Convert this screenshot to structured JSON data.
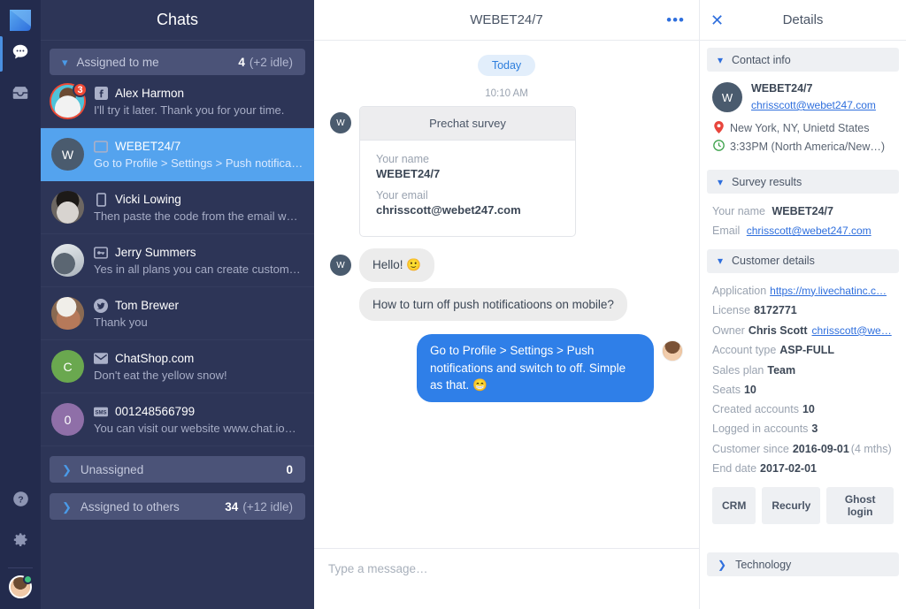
{
  "rail": {
    "logo_icon": "logo-icon",
    "items": [
      {
        "icon": "chat-bubble-icon",
        "name": "nav-chats",
        "active": true
      },
      {
        "icon": "inbox-icon",
        "name": "nav-archives",
        "active": false
      }
    ],
    "bottom": [
      {
        "icon": "help-icon",
        "name": "nav-help"
      },
      {
        "icon": "gear-icon",
        "name": "nav-settings"
      }
    ],
    "avatar_name": "current-user-avatar"
  },
  "chatlist": {
    "title": "Chats",
    "groups": {
      "assigned_to_me": {
        "label": "Assigned to me",
        "count": "4",
        "idle": "(+2 idle)",
        "chevron": "chevron-down-icon"
      },
      "unassigned": {
        "label": "Unassigned",
        "count": "0",
        "idle": "",
        "chevron": "chevron-right-icon"
      },
      "assigned_to_others": {
        "label": "Assigned to others",
        "count": "34",
        "idle": "(+12 idle)",
        "chevron": "chevron-right-icon"
      }
    },
    "items": [
      {
        "name": "Alex Harmon",
        "preview": "I'll try it later. Thank you for your time.",
        "channel": "facebook-icon",
        "badge": "3",
        "avatar_type": "photo",
        "avatar_color": "#4fc3d9",
        "selected": false
      },
      {
        "name": "WEBET24/7",
        "preview": "Go to Profile > Settings > Push notificatio…",
        "channel": "website-icon",
        "badge": "",
        "avatar_type": "initial",
        "avatar_initial": "W",
        "avatar_color": "#4a5b6e",
        "selected": true
      },
      {
        "name": "Vicki Lowing",
        "preview": "Then paste the code from the email we…",
        "channel": "mobile-icon",
        "badge": "",
        "avatar_type": "photo",
        "avatar_color": "#5a5450",
        "selected": false
      },
      {
        "name": "Jerry Summers",
        "preview": "Yes in all plans you can create custom c…",
        "channel": "ticket-icon",
        "badge": "",
        "avatar_type": "photo",
        "avatar_color": "#9aa5ad",
        "selected": false
      },
      {
        "name": "Tom Brewer",
        "preview": "Thank you",
        "channel": "twitter-icon",
        "badge": "",
        "avatar_type": "photo",
        "avatar_color": "#7d6a58",
        "selected": false
      },
      {
        "name": "ChatShop.com",
        "preview": "Don't eat the yellow snow!",
        "channel": "email-icon",
        "badge": "",
        "avatar_type": "initial",
        "avatar_initial": "C",
        "avatar_color": "#6aa84f",
        "selected": false
      },
      {
        "name": "001248566799",
        "preview": "You can visit our website www.chat.io…",
        "channel": "sms-icon",
        "badge": "",
        "avatar_type": "initial",
        "avatar_initial": "0",
        "avatar_color": "#8f6fa8",
        "selected": false
      }
    ]
  },
  "conversation": {
    "title": "WEBET24/7",
    "more_icon": "more-options-icon",
    "day_divider": "Today",
    "timestamp": "10:10 AM",
    "survey": {
      "title": "Prechat survey",
      "fields": [
        {
          "label": "Your name",
          "value": "WEBET24/7"
        },
        {
          "label": "Your email",
          "value": "chrisscott@webet247.com"
        }
      ]
    },
    "messages": [
      {
        "side": "in",
        "text": "Hello! 🙂",
        "avatar_initial": "W",
        "show_avatar": true
      },
      {
        "side": "in",
        "text": "How to turn off push notificatioons on mobile?",
        "avatar_initial": "W",
        "show_avatar": false
      },
      {
        "side": "out",
        "text": "Go to Profile > Settings > Push notifications and switch to off. Simple as that. 😁",
        "show_avatar": true
      }
    ],
    "composer_placeholder": "Type a message…",
    "composer_value": ""
  },
  "details": {
    "title": "Details",
    "close_icon": "close-icon",
    "sections": {
      "contact_info": {
        "label": "Contact info",
        "chevron": "chevron-down-icon"
      },
      "survey_results": {
        "label": "Survey results",
        "chevron": "chevron-down-icon"
      },
      "customer_details": {
        "label": "Customer details",
        "chevron": "chevron-down-icon"
      },
      "technology": {
        "label": "Technology",
        "chevron": "chevron-right-icon"
      }
    },
    "contact": {
      "avatar_initial": "W",
      "name": "WEBET24/7",
      "email": "chrisscott@webet247.com",
      "location": "New York, NY, Unietd States",
      "location_icon": "location-pin-icon",
      "time": "3:33PM (North America/New…)",
      "time_icon": "clock-icon"
    },
    "survey_results": [
      {
        "label": "Your name",
        "value": "WEBET24/7",
        "link": false
      },
      {
        "label": "Email",
        "value": "chrisscott@webet247.com",
        "link": true
      }
    ],
    "customer_details": [
      {
        "label": "Application",
        "value": "https://my.livechatinc.c…",
        "link": true
      },
      {
        "label": "License",
        "value": "8172771",
        "link": false
      },
      {
        "label": "Owner",
        "value": "Chris Scott",
        "extra": "chrisscott@we…",
        "link": false
      },
      {
        "label": "Account type",
        "value": "ASP-FULL",
        "link": false
      },
      {
        "label": "Sales plan",
        "value": "Team",
        "link": false
      },
      {
        "label": "Seats",
        "value": "10",
        "link": false
      },
      {
        "label": "Created accounts",
        "value": "10",
        "link": false
      },
      {
        "label": "Logged in accounts",
        "value": "3",
        "link": false
      },
      {
        "label": "Customer since",
        "value": "2016-09-01",
        "note": "(4 mths)",
        "link": false
      },
      {
        "label": "End date",
        "value": "2017-02-01",
        "link": false
      }
    ],
    "buttons": [
      {
        "label": "CRM",
        "name": "crm-button"
      },
      {
        "label": "Recurly",
        "name": "recurly-button"
      },
      {
        "label": "Ghost login",
        "name": "ghost-login-button"
      }
    ]
  },
  "colors": {
    "rail_bg": "#232b4d",
    "sidebar_bg": "#2d3557",
    "selected_row": "#54a3ee",
    "accent_blue": "#2f7fe8",
    "link_blue": "#2f6fdd",
    "badge_red": "#ef4a35",
    "online_green": "#3fc380"
  }
}
